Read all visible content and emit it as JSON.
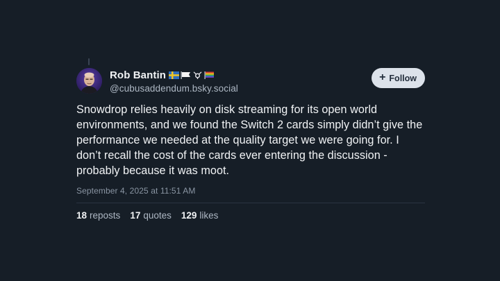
{
  "author": {
    "display_name": "Rob Bantin",
    "handle": "@cubusaddendum.bsky.social",
    "flags": [
      "sweden-flag-icon",
      "white-flag-icon",
      "transgender-symbol-icon",
      "rainbow-flag-icon"
    ]
  },
  "follow_button": {
    "icon": "plus-icon",
    "label": "Follow"
  },
  "post": {
    "text": "Snowdrop relies heavily on disk streaming for its open world environments, and we found the Switch 2 cards simply didn’t give the performance we needed at the quality target we were going for. I don’t recall the cost of the cards ever entering the discussion - probably because it was moot.",
    "timestamp": "September 4, 2025 at 11:51 AM"
  },
  "stats": {
    "reposts_count": "18",
    "reposts_label": "reposts",
    "quotes_count": "17",
    "quotes_label": "quotes",
    "likes_count": "129",
    "likes_label": "likes"
  },
  "colors": {
    "background": "#161e27",
    "text_primary": "#f1f3f5",
    "text_secondary": "#aeb8c4",
    "button_bg": "#dce2ea"
  }
}
